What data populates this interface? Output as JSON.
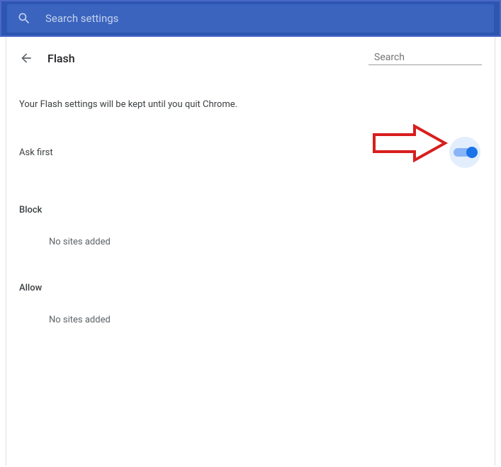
{
  "topSearch": {
    "placeholder": "Search settings"
  },
  "header": {
    "title": "Flash",
    "searchPlaceholder": "Search"
  },
  "infoText": "Your Flash settings will be kept until you quit Chrome.",
  "askFirst": {
    "label": "Ask first",
    "enabled": true
  },
  "blockSection": {
    "heading": "Block",
    "emptyText": "No sites added"
  },
  "allowSection": {
    "heading": "Allow",
    "emptyText": "No sites added"
  }
}
